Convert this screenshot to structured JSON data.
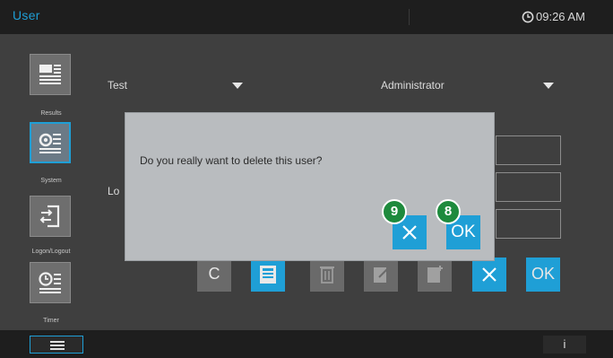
{
  "header": {
    "title": "User",
    "time": "09:26 AM",
    "clock_icon": "clock-icon"
  },
  "sidebar": {
    "items": [
      {
        "label": "Results",
        "icon": "results-icon"
      },
      {
        "label": "System",
        "icon": "system-icon",
        "active": true
      },
      {
        "label": "Logon/Logout",
        "icon": "logon-logout-icon"
      },
      {
        "label": "Timer",
        "icon": "timer-icon"
      }
    ]
  },
  "form": {
    "user_select": "Test",
    "role_select": "Administrator",
    "partial_label": "Lo"
  },
  "toolbar": {
    "clear_label": "C",
    "ok_label": "OK",
    "icons": [
      "save-icon",
      "delete-icon",
      "edit-icon",
      "add-icon",
      "close-icon"
    ]
  },
  "dialog": {
    "message": "Do you really want to delete this user?",
    "ok_label": "OK",
    "badge_cancel": "9",
    "badge_ok": "8"
  },
  "colors": {
    "accent": "#1f9fd6",
    "badge": "#1e8a3d",
    "header_bg": "#1e1e1e",
    "dialog_bg": "#b9bcbf"
  }
}
